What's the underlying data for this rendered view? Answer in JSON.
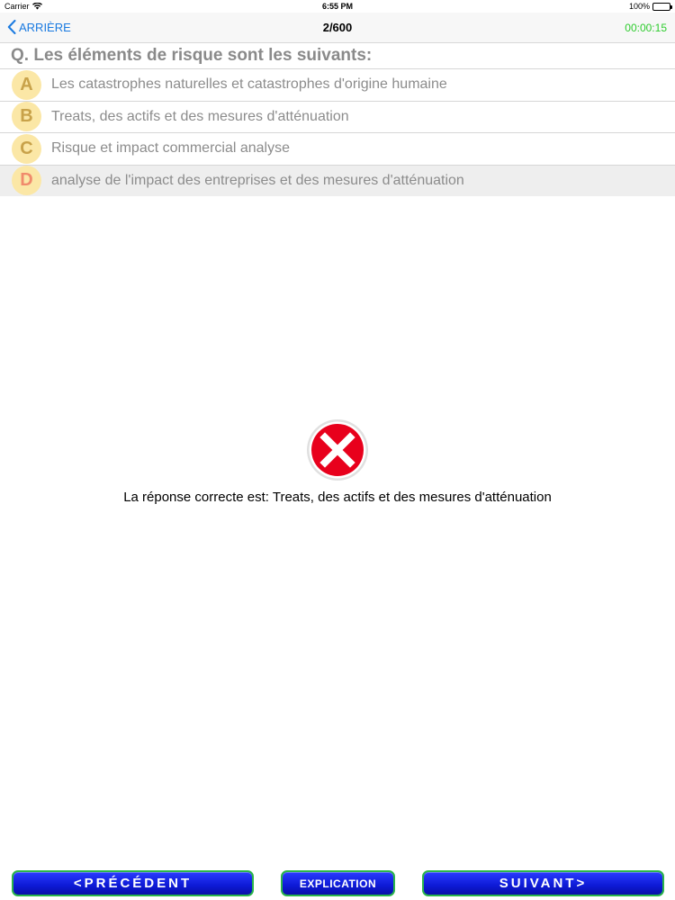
{
  "status_bar": {
    "carrier": "Carrier",
    "time": "6:55 PM",
    "battery": "100%"
  },
  "nav": {
    "back_label": "ARRIÈRE",
    "title": "2/600",
    "timer": "00:00:15"
  },
  "question": "Q. Les éléments de risque sont les suivants:",
  "answers": [
    {
      "letter": "A",
      "text": "Les catastrophes naturelles et catastrophes d'origine humaine"
    },
    {
      "letter": "B",
      "text": "Treats, des actifs et des mesures d'atténuation"
    },
    {
      "letter": "C",
      "text": "Risque et impact commercial analyse"
    },
    {
      "letter": "D",
      "text": "analyse de l'impact des entreprises et des mesures d'atténuation"
    }
  ],
  "result": {
    "icon": "wrong-answer-icon",
    "text": "La réponse correcte est:  Treats, des actifs et des mesures d'atténuation"
  },
  "buttons": {
    "prev": "<PRÉCÉDENT",
    "explanation": "EXPLICATION",
    "next": "SUIVANT>"
  },
  "colors": {
    "link_blue": "#1a7ae0",
    "timer_green": "#2ecc2e",
    "badge_yellow": "#fbe7a6",
    "wrong_red": "#e8001c",
    "button_blue": "#1420e6",
    "button_border_green": "#2bb54a"
  }
}
